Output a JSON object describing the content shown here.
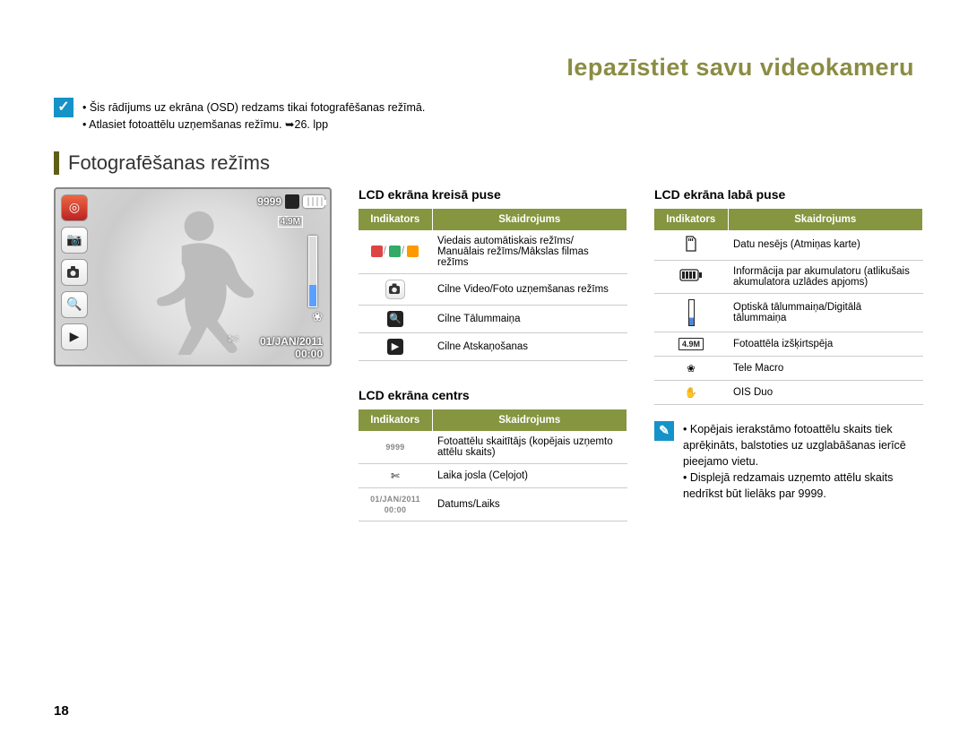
{
  "pageTitle": "Iepazīstiet savu videokameru",
  "introLines": [
    "Šis rādījums uz ekrāna (OSD) redzams tikai fotografēšanas režīmā.",
    "Atlasiet fotoattēlu uzņemšanas režīmu. ➥26. lpp"
  ],
  "sectionTitle": "Fotografēšanas režīms",
  "lcd": {
    "counter": "9999",
    "resolution": "4.9M",
    "date": "01/JAN/2011",
    "time": "00:00"
  },
  "leftTable": {
    "heading": "LCD ekrāna kreisā puse",
    "th1": "Indikators",
    "th2": "Skaidrojums",
    "rows": [
      {
        "iconType": "modes",
        "desc": "Viedais automātiskais režīms/ Manuālais režīms/Mākslas filmas režīms"
      },
      {
        "iconType": "tab",
        "desc": "Cilne Video/Foto uzņemšanas režīms"
      },
      {
        "iconType": "zoom",
        "desc": "Cilne Tālummaiņa"
      },
      {
        "iconType": "play",
        "desc": "Cilne Atskaņošanas"
      }
    ]
  },
  "centerTable": {
    "heading": "LCD ekrāna centrs",
    "th1": "Indikators",
    "th2": "Skaidrojums",
    "rows": [
      {
        "label": "9999",
        "desc": "Fotoattēlu skaitītājs (kopējais uzņemto attēlu skaits)"
      },
      {
        "iconType": "scissors",
        "desc": "Laika josla (Ceļojot)"
      },
      {
        "label": "01/JAN/2011\n00:00",
        "desc": "Datums/Laiks"
      }
    ]
  },
  "rightTable": {
    "heading": "LCD ekrāna labā puse",
    "th1": "Indikators",
    "th2": "Skaidrojums",
    "rows": [
      {
        "iconType": "sd",
        "desc": "Datu nesējs (Atmiņas karte)"
      },
      {
        "iconType": "batt",
        "desc": "Informācija par akumulatoru (atlikušais akumulatora uzlādes apjoms)"
      },
      {
        "iconType": "zoombar",
        "desc": "Optiskā tālummaiņa/Digitālā tālummaiņa"
      },
      {
        "label": "4.9M",
        "desc": "Fotoattēla izšķirtspēja"
      },
      {
        "iconType": "flower",
        "desc": "Tele Macro"
      },
      {
        "iconType": "hand",
        "desc": "OIS Duo"
      }
    ]
  },
  "noteLines": [
    "Kopējais ierakstāmo fotoattēlu skaits tiek aprēķināts, balstoties uz uzglabāšanas ierīcē pieejamo vietu.",
    "Displejā redzamais uzņemto attēlu skaits nedrīkst būt lielāks par 9999."
  ],
  "pageNumber": "18"
}
